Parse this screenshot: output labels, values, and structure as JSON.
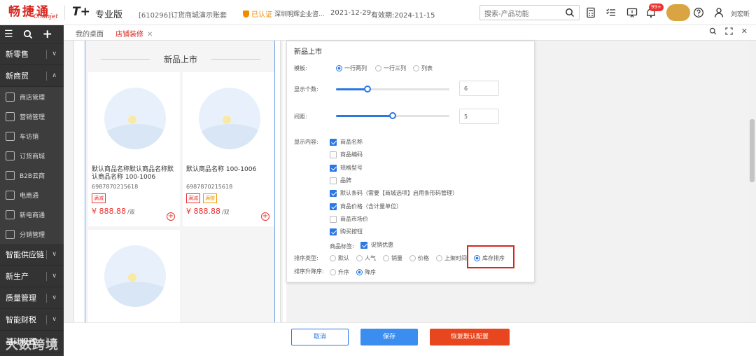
{
  "header": {
    "logo_cn": "畅捷通",
    "logo_en": "Chanjet",
    "product": "T+",
    "edition": "专业版",
    "account": "[610296]订货商城演示账套",
    "verified": "已认证",
    "company": "深圳明辉企业咨...",
    "date": "2021-12-29",
    "expire": "有效期:2024-11-15",
    "search_placeholder": "搜索-产品功能",
    "notif_badge": "99+",
    "username": "刘宏昕"
  },
  "sidebar": {
    "sections": [
      {
        "label": "新零售",
        "expanded": false
      },
      {
        "label": "新商贸",
        "expanded": true
      }
    ],
    "sub_items": [
      {
        "label": "商店管理",
        "icon": "shop-icon"
      },
      {
        "label": "营销管理",
        "icon": "chart-icon"
      },
      {
        "label": "车访销",
        "icon": "car-icon"
      },
      {
        "label": "订货商城",
        "icon": "store-icon"
      },
      {
        "label": "B2B云商",
        "icon": "building-icon"
      },
      {
        "label": "电商通",
        "icon": "ecommerce-icon"
      },
      {
        "label": "新电商通",
        "icon": "new-ecommerce-icon"
      },
      {
        "label": "分销管理",
        "icon": "distribution-icon"
      }
    ],
    "bottom_sections": [
      {
        "label": "智能供应链"
      },
      {
        "label": "新生产"
      },
      {
        "label": "质量管理"
      },
      {
        "label": "智能财税"
      },
      {
        "label": "基础设置"
      }
    ]
  },
  "tabs": [
    {
      "label": "我的桌面",
      "active": false
    },
    {
      "label": "店铺装修",
      "active": true
    }
  ],
  "preview": {
    "title": "新品上市",
    "products": [
      {
        "name": "默认商品名称默认商品名称默认商品名称 100-1006",
        "code": "6987870215618",
        "tags": [
          "满减",
          "满减"
        ],
        "price": "¥ 888.88",
        "unit": "/双"
      },
      {
        "name": "默认商品名称 100-1006",
        "code": "6987870215618",
        "tags": [
          "满减",
          "满赠"
        ],
        "price": "¥ 888.88",
        "unit": "/双"
      }
    ]
  },
  "settings": {
    "title": "新品上市",
    "template_label": "模板:",
    "template_options": [
      "一行两列",
      "一行三列",
      "列表"
    ],
    "template_selected": 0,
    "count_label": "显示个数:",
    "count_value": "6",
    "count_level": 0.28,
    "spacing_label": "间距:",
    "spacing_value": "5",
    "spacing_level": 0.5,
    "display_label": "显示内容:",
    "display_items": [
      {
        "label": "商品名称",
        "checked": true
      },
      {
        "label": "商品编码",
        "checked": false
      },
      {
        "label": "规格型号",
        "checked": true
      },
      {
        "label": "品牌",
        "checked": false
      },
      {
        "label": "默认条码（需要【商城选项】启用条形码管理）",
        "checked": true
      },
      {
        "label": "商品价格（含计量单位）",
        "checked": true
      },
      {
        "label": "商品市场价",
        "checked": false
      },
      {
        "label": "购买按钮",
        "checked": true
      }
    ],
    "tag_label": "商品标签:",
    "tag_option": "促销优惠",
    "sort_label": "排序类型:",
    "sort_options": [
      "默认",
      "人气",
      "销量",
      "价格",
      "上架时间",
      "库存排序"
    ],
    "sort_selected": 5,
    "order_label": "排序升降序:",
    "order_options": [
      "升序",
      "降序"
    ],
    "order_selected": 1
  },
  "footer": {
    "cancel": "取消",
    "save": "保存",
    "reset": "恢复默认配置"
  },
  "watermark": "大数跨境"
}
